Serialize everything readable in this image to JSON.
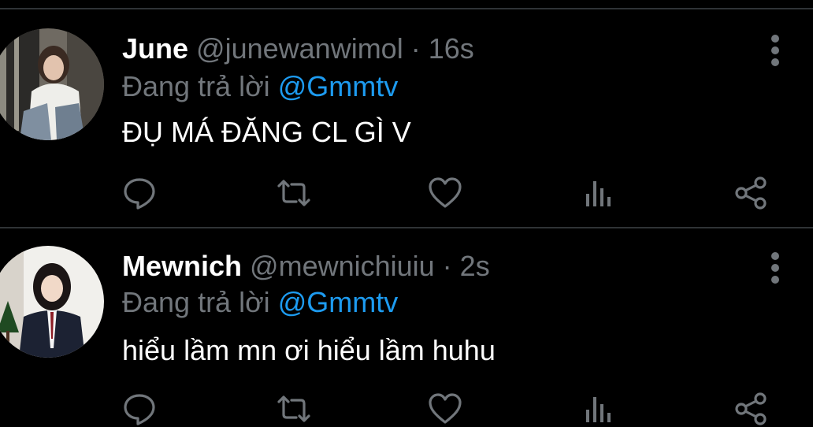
{
  "tweets": [
    {
      "name": "June",
      "handle": "@junewanwimol",
      "time": "16s",
      "reply_prefix": "Đang trả lời",
      "reply_to": "@Gmmtv",
      "text": "ĐỤ MÁ ĐĂNG CL GÌ V",
      "avatar_icon": "user-avatar"
    },
    {
      "name": "Mewnich",
      "handle": "@mewnichiuiu",
      "time": "2s",
      "reply_prefix": "Đang trả lời",
      "reply_to": "@Gmmtv",
      "text": "hiểu lầm mn ơi hiểu lầm huhu",
      "avatar_icon": "user-avatar"
    }
  ],
  "separator": " · ",
  "icons": [
    "reply-icon",
    "retweet-icon",
    "like-icon",
    "analytics-icon",
    "share-icon",
    "more-options-icon"
  ],
  "colors": {
    "background": "#000000",
    "text": "#e7e9ea",
    "muted": "#71767b",
    "link": "#1d9bf0",
    "divider": "#2f3336"
  }
}
